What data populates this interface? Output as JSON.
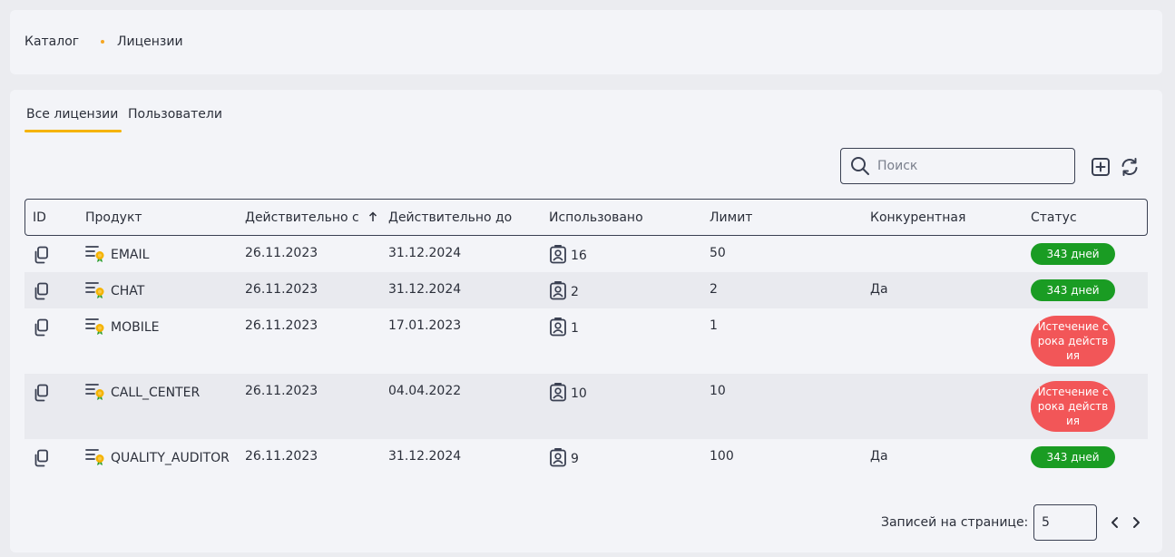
{
  "breadcrumb": {
    "items": [
      "Каталог",
      "Лицензии"
    ]
  },
  "tabs": [
    {
      "label": "Все лицензии",
      "active": true
    },
    {
      "label": "Пользователи",
      "active": false
    }
  ],
  "search": {
    "placeholder": "Поиск",
    "value": ""
  },
  "toolbar": {
    "add_icon": "plus-square-icon",
    "refresh_icon": "refresh-icon"
  },
  "table": {
    "columns": [
      "ID",
      "Продукт",
      "Действительно с",
      "Действительно до",
      "Использовано",
      "Лимит",
      "Конкурентная",
      "Статус"
    ],
    "sort": {
      "column": "Действительно с",
      "direction": "asc"
    },
    "rows": [
      {
        "product": "EMAIL",
        "valid_from": "26.11.2023",
        "valid_to": "31.12.2024",
        "used": "16",
        "limit": "50",
        "concurrent": "",
        "status": "343 дней",
        "status_type": "ok"
      },
      {
        "product": "CHAT",
        "valid_from": "26.11.2023",
        "valid_to": "31.12.2024",
        "used": "2",
        "limit": "2",
        "concurrent": "Да",
        "status": "343 дней",
        "status_type": "ok"
      },
      {
        "product": "MOBILE",
        "valid_from": "26.11.2023",
        "valid_to": "17.01.2023",
        "used": "1",
        "limit": "1",
        "concurrent": "",
        "status": "Истечение срока действия",
        "status_type": "expired"
      },
      {
        "product": "CALL_CENTER",
        "valid_from": "26.11.2023",
        "valid_to": "04.04.2022",
        "used": "10",
        "limit": "10",
        "concurrent": "",
        "status": "Истечение срока действия",
        "status_type": "expired"
      },
      {
        "product": "QUALITY_AUDITOR",
        "valid_from": "26.11.2023",
        "valid_to": "31.12.2024",
        "used": "9",
        "limit": "100",
        "concurrent": "Да",
        "status": "343 дней",
        "status_type": "ok"
      }
    ]
  },
  "pagination": {
    "label": "Записей на странице:",
    "page_size": "5"
  },
  "colors": {
    "accent": "#f5b301",
    "ok": "#1a9c23",
    "expired": "#f25658"
  }
}
